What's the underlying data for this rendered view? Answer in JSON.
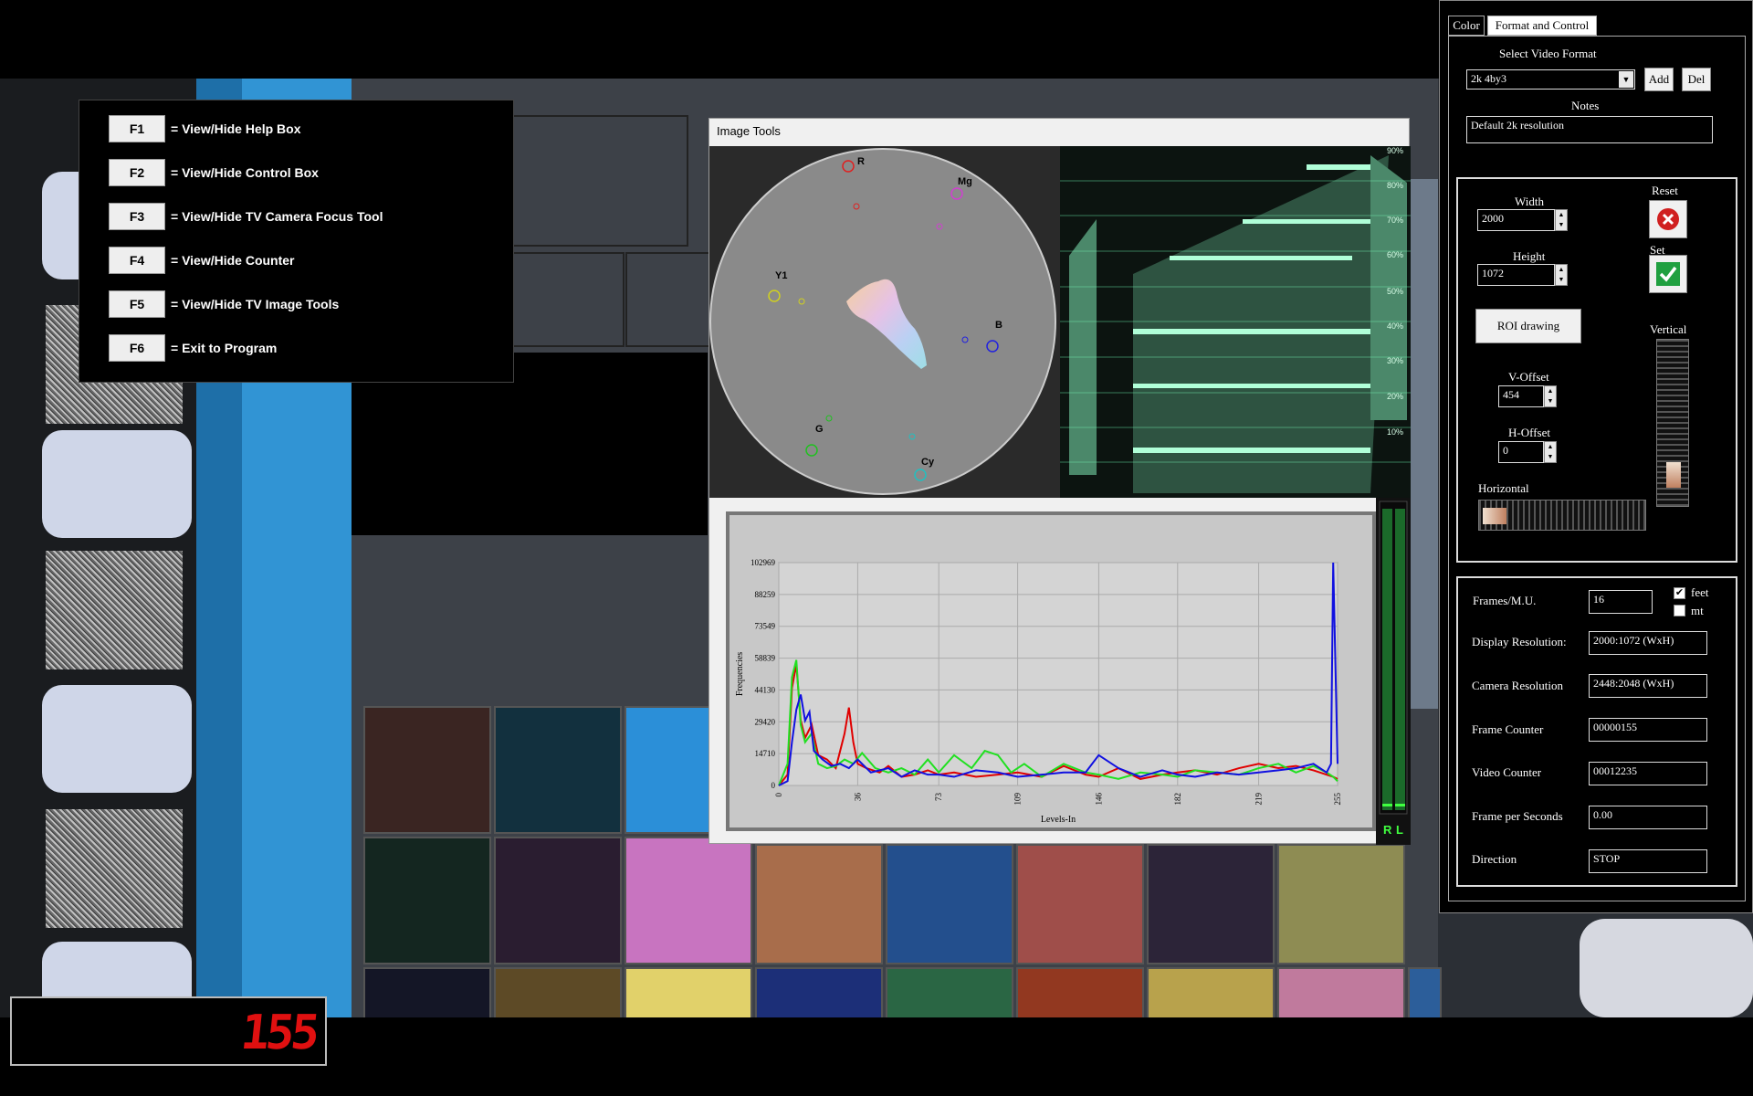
{
  "help": {
    "rows": [
      {
        "key": "F1",
        "desc": "= View/Hide Help Box"
      },
      {
        "key": "F2",
        "desc": "= View/Hide Control Box"
      },
      {
        "key": "F3",
        "desc": "= View/Hide TV Camera Focus Tool"
      },
      {
        "key": "F4",
        "desc": "= View/Hide Counter"
      },
      {
        "key": "F5",
        "desc": "= View/Hide TV Image Tools"
      },
      {
        "key": "F6",
        "desc": "= Exit to Program"
      }
    ]
  },
  "counter": {
    "value": "155",
    "color": "#e01010"
  },
  "tools": {
    "title": "Image Tools",
    "vectorscope": {
      "labels": [
        "R",
        "Mg",
        "Y1",
        "B",
        "G",
        "Cy"
      ]
    },
    "waveform": {
      "labels": [
        "90%",
        "80%",
        "70%",
        "60%",
        "50%",
        "40%",
        "30%",
        "20%",
        "10%"
      ]
    },
    "meter": {
      "labels": [
        "R",
        "L"
      ]
    }
  },
  "chart_data": {
    "type": "line",
    "title": "",
    "xlabel": "Levels-In",
    "ylabel": "Frequencies",
    "xticks": [
      0,
      36,
      73,
      109,
      146,
      182,
      219,
      255
    ],
    "yticks": [
      0,
      14710,
      29420,
      44130,
      58839,
      73549,
      88259,
      102969
    ],
    "xlim": [
      0,
      255
    ],
    "ylim": [
      0,
      102969
    ],
    "grid": true,
    "series": [
      {
        "color": "#e00000",
        "x": [
          0,
          4,
          6,
          8,
          10,
          12,
          15,
          18,
          22,
          26,
          30,
          32,
          34,
          36,
          40,
          46,
          50,
          56,
          62,
          68,
          73,
          80,
          90,
          100,
          109,
          120,
          130,
          140,
          146,
          155,
          165,
          175,
          182,
          190,
          200,
          210,
          219,
          228,
          236,
          244,
          250,
          253,
          255
        ],
        "values": [
          0,
          5000,
          45000,
          56000,
          30000,
          22000,
          28000,
          14000,
          12000,
          8000,
          24000,
          36000,
          20000,
          10000,
          8000,
          6000,
          9000,
          4000,
          5000,
          7000,
          5000,
          6000,
          4000,
          5000,
          6000,
          4000,
          9000,
          5000,
          4000,
          8000,
          3000,
          5000,
          6000,
          7000,
          5000,
          8000,
          10000,
          8000,
          9000,
          7000,
          5000,
          4000,
          3000
        ]
      },
      {
        "color": "#20e020",
        "x": [
          0,
          4,
          6,
          8,
          10,
          12,
          15,
          18,
          22,
          26,
          30,
          34,
          38,
          44,
          50,
          56,
          62,
          68,
          73,
          80,
          88,
          94,
          100,
          106,
          112,
          120,
          130,
          140,
          146,
          155,
          165,
          175,
          182,
          190,
          200,
          210,
          219,
          228,
          236,
          244,
          250,
          253,
          255
        ],
        "values": [
          0,
          10000,
          50000,
          58000,
          28000,
          20000,
          24000,
          10000,
          8000,
          9000,
          12000,
          10000,
          15000,
          8000,
          6000,
          8000,
          5000,
          12000,
          6000,
          14000,
          8000,
          16000,
          14000,
          6000,
          10000,
          4000,
          10000,
          6000,
          5000,
          3000,
          6000,
          5000,
          4000,
          7000,
          6000,
          5000,
          8000,
          10000,
          6000,
          9000,
          6000,
          4000,
          2000
        ]
      },
      {
        "color": "#1010e0",
        "x": [
          0,
          4,
          6,
          8,
          10,
          12,
          14,
          16,
          20,
          24,
          28,
          32,
          36,
          42,
          50,
          56,
          62,
          68,
          73,
          80,
          90,
          100,
          109,
          120,
          130,
          140,
          146,
          155,
          165,
          175,
          182,
          190,
          200,
          210,
          219,
          228,
          236,
          244,
          250,
          252,
          253,
          255
        ],
        "values": [
          0,
          2000,
          20000,
          35000,
          42000,
          30000,
          34000,
          16000,
          12000,
          9000,
          10000,
          8000,
          12000,
          6000,
          8000,
          4000,
          7000,
          5000,
          5000,
          4000,
          7000,
          6000,
          4000,
          5000,
          6000,
          6000,
          14000,
          8000,
          4000,
          7000,
          5000,
          4000,
          6000,
          5000,
          6000,
          7000,
          8000,
          10000,
          6000,
          10000,
          102969,
          10000
        ]
      }
    ]
  },
  "panel": {
    "tabs": [
      "Color",
      "Format and Control"
    ],
    "select_video_format_label": "Select Video Format",
    "video_format_value": "2k 4by3",
    "add_label": "Add",
    "del_label": "Del",
    "notes_label": "Notes",
    "notes_value": "Default 2k resolution",
    "width_label": "Width",
    "width_value": "2000",
    "height_label": "Height",
    "height_value": "1072",
    "reset_label": "Reset",
    "set_label": "Set",
    "roi_label": "ROI drawing",
    "vertical_label": "Vertical",
    "voffset_label": "V-Offset",
    "voffset_value": "454",
    "hoffset_label": "H-Offset",
    "hoffset_value": "0",
    "horizontal_label": "Horizontal",
    "frames_mu_label": "Frames/M.U.",
    "frames_mu_value": "16",
    "feet_label": "feet",
    "mt_label": "mt",
    "feet_checked": true,
    "mt_checked": false,
    "display_res_label": "Display Resolution:",
    "display_res_value": "2000:1072 (WxH)",
    "camera_res_label": "Camera Resolution",
    "camera_res_value": "2448:2048 (WxH)",
    "frame_counter_label": "Frame Counter",
    "frame_counter_value": "00000155",
    "video_counter_label": "Video Counter",
    "video_counter_value": "00012235",
    "fps_label": "Frame per Seconds",
    "fps_value": "0.00",
    "direction_label": "Direction",
    "direction_value": "STOP"
  }
}
